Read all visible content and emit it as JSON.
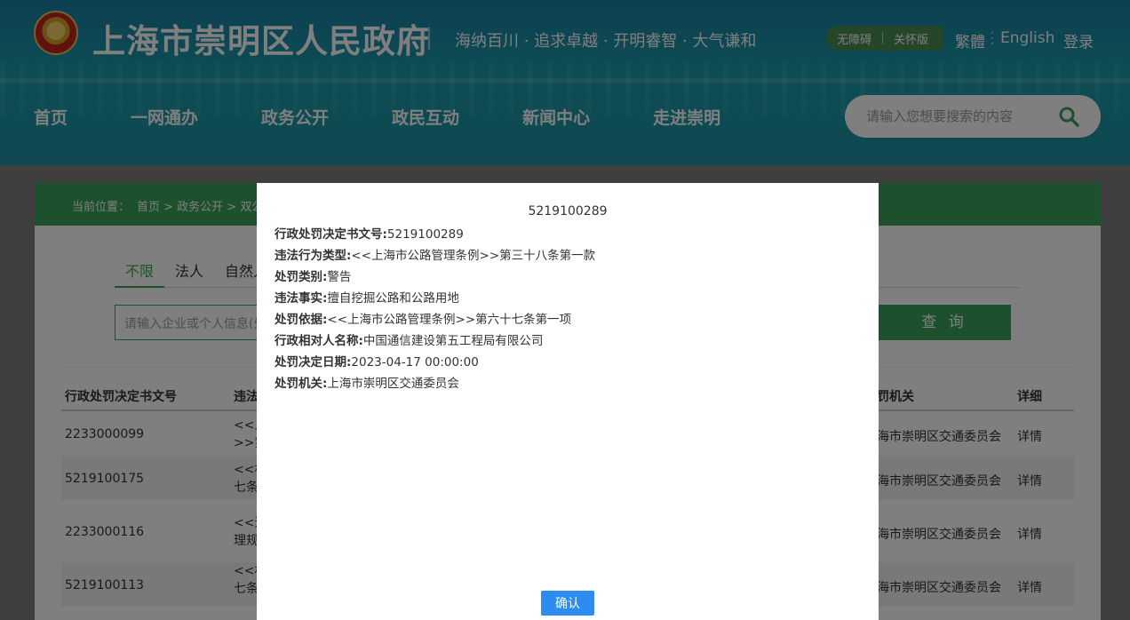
{
  "header": {
    "site_title": "上海市崇明区人民政府",
    "slogan": "海纳百川 · 追求卓越 · 开明睿智 · 大气谦和",
    "accessibility": "无障碍",
    "care_mode": "关怀版",
    "traditional": "繁體",
    "english": "English",
    "login": "登录"
  },
  "nav": [
    "首页",
    "一网通办",
    "政务公开",
    "政民互动",
    "新闻中心",
    "走进崇明"
  ],
  "search": {
    "placeholder": "请输入您想要搜索的内容"
  },
  "breadcrumb": {
    "label": "当前位置：",
    "path": "首页 > 政务公开 > 双公"
  },
  "filter_tabs": [
    "不限",
    "法人",
    "自然人"
  ],
  "query": {
    "placeholder": "请输入企业或个人信息(处",
    "button": "查 询"
  },
  "table": {
    "headers": [
      "行政处罚决定书文号",
      "违法",
      "罚机关",
      "详细"
    ],
    "rows": [
      {
        "doc_no": "2233000099",
        "violation": "<<上\n>>第",
        "agency": "海市崇明区交通委员会",
        "detail": "详情"
      },
      {
        "doc_no": "5219100175",
        "violation": "<<机\n七条",
        "agency": "海市崇明区交通委员会",
        "detail": "详情"
      },
      {
        "doc_no": "2233000116",
        "violation": "<<道\n理规",
        "agency": "海市崇明区交通委员会",
        "detail": "详情"
      },
      {
        "doc_no": "5219100113",
        "violation": "<<机\n七条",
        "agency": "海市崇明区交通委员会",
        "detail": "详情"
      }
    ]
  },
  "dialog": {
    "title": "5219100289",
    "fields": [
      {
        "label": "行政处罚决定书文号:",
        "value": "5219100289"
      },
      {
        "label": "违法行为类型:",
        "value": "<<上海市公路管理条例>>第三十八条第一款"
      },
      {
        "label": "处罚类别:",
        "value": "警告"
      },
      {
        "label": "违法事实:",
        "value": "擅自挖掘公路和公路用地"
      },
      {
        "label": "处罚依据:",
        "value": "<<上海市公路管理条例>>第六十七条第一项"
      },
      {
        "label": "行政相对人名称:",
        "value": "中国通信建设第五工程局有限公司"
      },
      {
        "label": "处罚决定日期:",
        "value": "2023-04-17 00:00:00"
      },
      {
        "label": "处罚机关:",
        "value": "上海市崇明区交通委员会"
      }
    ],
    "confirm": "确认"
  },
  "colors": {
    "brand_green": "#3aa35a",
    "confirm_blue": "#2d8cf0",
    "overlay": "rgba(0,0,0,0.5)"
  }
}
